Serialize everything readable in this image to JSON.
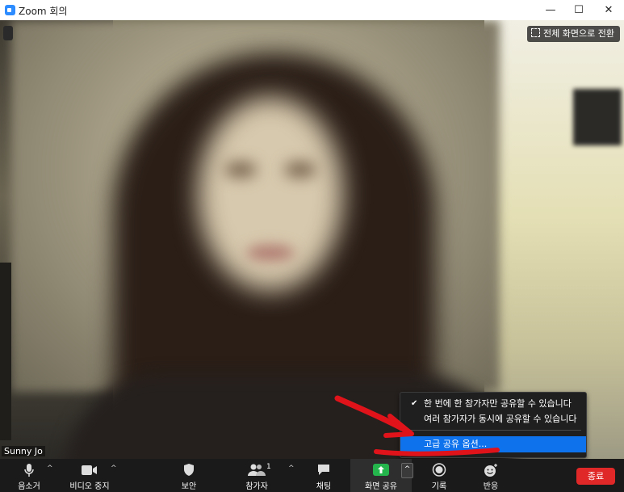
{
  "window": {
    "title": "Zoom 회의",
    "minimize": "—",
    "maximize": "☐",
    "close": "✕"
  },
  "video": {
    "fullscreen_label": "전체 화면으로 전환",
    "participant_name": "Sunny Jo"
  },
  "share_menu": {
    "items": [
      {
        "label": "한 번에 한 참가자만 공유할 수 있습니다",
        "checked": true
      },
      {
        "label": "여러 참가자가 동시에 공유할 수 있습니다",
        "checked": false
      }
    ],
    "advanced": "고급 공유 옵션..."
  },
  "toolbar": {
    "mute": "음소거",
    "stop_video": "비디오 중지",
    "security": "보안",
    "participants": "참가자",
    "participants_count": "1",
    "chat": "채팅",
    "share_screen": "화면 공유",
    "record": "기록",
    "reactions": "반응",
    "end": "종료",
    "caret": "^"
  },
  "colors": {
    "accent": "#0e72ed",
    "share_green": "#25b54d",
    "end_red": "#e02828",
    "annotation_red": "#e0131a"
  }
}
